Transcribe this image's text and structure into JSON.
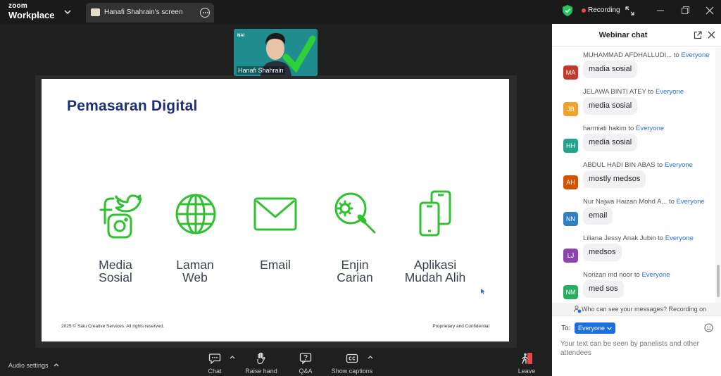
{
  "app": {
    "brand_line1": "zoom",
    "brand_line2": "Workplace"
  },
  "tab": {
    "title": "Hanafi Shahrain's screen"
  },
  "status": {
    "recording_label": "Recording"
  },
  "speaker": {
    "name": "Hanafi Shahrain"
  },
  "slide": {
    "title": "Pemasaran Digital",
    "items": [
      {
        "label_line1": "Media",
        "label_line2": "Sosial",
        "icon": "social-media-icon"
      },
      {
        "label_line1": "Laman",
        "label_line2": "Web",
        "icon": "globe-icon"
      },
      {
        "label_line1": "Email",
        "label_line2": "",
        "icon": "envelope-icon"
      },
      {
        "label_line1": "Enjin",
        "label_line2": "Carian",
        "icon": "search-gear-icon"
      },
      {
        "label_line1": "Aplikasi",
        "label_line2": "Mudah Alih",
        "icon": "mobile-devices-icon"
      }
    ],
    "footer_left": "2025 © Satu Creative Services. All rights reserved.",
    "footer_right": "Proprietary and Confidential",
    "accent_color": "#2fc12f",
    "title_color": "#1e2f7a"
  },
  "toolbar": {
    "audio_settings": "Audio settings",
    "chat": "Chat",
    "raise_hand": "Raise hand",
    "qa": "Q&A",
    "show_captions": "Show captions",
    "leave": "Leave"
  },
  "chat": {
    "title": "Webinar chat",
    "messages": [
      {
        "sender": "MUHAMMAD AFDHALLUDI...",
        "to": "to",
        "recipient": "Everyone",
        "initials": "MA",
        "color": "#c0392b",
        "text": "madia sosial"
      },
      {
        "sender": "JELAWA BINTI ATEY",
        "to": "to",
        "recipient": "Everyone",
        "initials": "JB",
        "color": "#f0a22e",
        "text": "media sosial"
      },
      {
        "sender": "harmiati hakim",
        "to": "to",
        "recipient": "Everyone",
        "initials": "HH",
        "color": "#22a38a",
        "text": "media sosial"
      },
      {
        "sender": "ABDUL HADI BIN ABAS",
        "to": "to",
        "recipient": "Everyone",
        "initials": "AH",
        "color": "#d35400",
        "text": "mostly medsos"
      },
      {
        "sender": "Nur Najwa Haizan Mohd A...",
        "to": "to",
        "recipient": "Everyone",
        "initials": "NN",
        "color": "#2f7fc1",
        "text": "email"
      },
      {
        "sender": "Liliana Jessy Anak Jubin",
        "to": "to",
        "recipient": "Everyone",
        "initials": "LJ",
        "color": "#8e44ad",
        "text": "medsos"
      },
      {
        "sender": "Norizan md noor",
        "to": "to",
        "recipient": "Everyone",
        "initials": "NM",
        "color": "#27ae60",
        "text": "med sos"
      }
    ],
    "privacy_text": "Who can see your messages? Recording on",
    "to_label": "To:",
    "recipient_selected": "Everyone",
    "composer_placeholder": "Your text can be seen by panelists and other attendees"
  }
}
